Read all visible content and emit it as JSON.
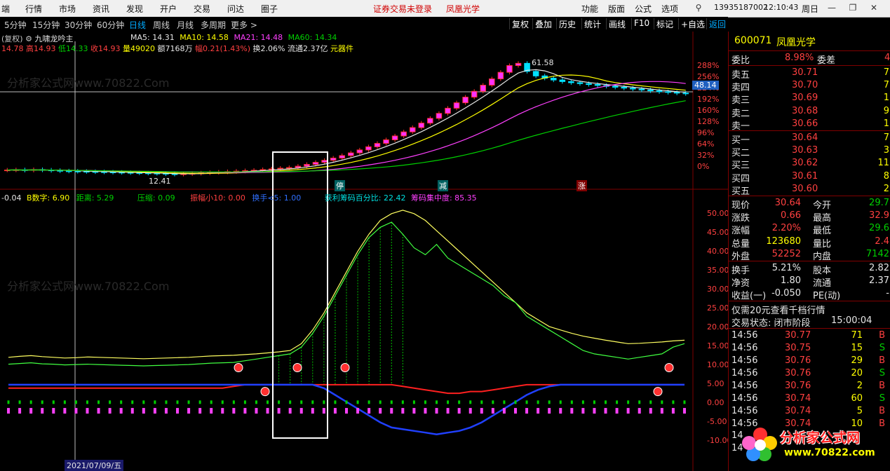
{
  "menu": {
    "items": [
      "端",
      "行情",
      "市场",
      "资讯",
      "发现",
      "开户",
      "交易",
      "问达",
      "圈子"
    ],
    "notice": "证券交易未登录",
    "stock_name": "凤凰光学",
    "right_items": [
      "功能",
      "版面",
      "公式",
      "选项"
    ],
    "account": "13935187002",
    "time": "12:10:43",
    "weekday": "周日"
  },
  "period_bar": {
    "periods": [
      "5分钟",
      "15分钟",
      "30分钟",
      "60分钟",
      "日线",
      "周线",
      "月线",
      "多周期",
      "更多 >"
    ],
    "active": "日线",
    "tools": [
      "复权",
      "叠加",
      "历史",
      "统计",
      "画线",
      "F10",
      "标记",
      "+自选",
      "返回"
    ]
  },
  "kline": {
    "header": {
      "prefix": "(复权)",
      "indicator_name": "九啸龙吟主",
      "ma5": "MA5: 14.31",
      "ma10": "MA10: 14.58",
      "ma21": "MA21: 14.48",
      "ma60": "MA60: 14.34"
    },
    "quote_line": {
      "open": "14.78",
      "high": "高14.93",
      "low": "低14.33",
      "close": "收14.93",
      "volume": "量49020",
      "amount": "额7168万",
      "change": "幅0.21(1.43%)",
      "turnover": "换2.06%",
      "float": "流通2.37亿",
      "component": "元器件"
    },
    "y_labels": [
      "288%",
      "256%",
      "224%",
      "192%",
      "160%",
      "128%",
      "96%",
      "64%",
      "32%",
      "0%"
    ],
    "price_tag": "48.14",
    "peak_label": "61.58",
    "low_label": "12.41",
    "signals": {
      "start": "停",
      "mid": "减",
      "up": "涨"
    },
    "close_series": [
      14.3,
      14.4,
      14.2,
      14.5,
      14.3,
      14.1,
      13.9,
      13.8,
      13.7,
      13.6,
      13.5,
      13.4,
      13.3,
      13.2,
      13.1,
      13.0,
      12.9,
      12.8,
      12.6,
      12.41,
      12.6,
      12.8,
      13.0,
      13.2,
      13.4,
      13.6,
      13.8,
      14.0,
      14.2,
      14.5,
      14.8,
      15.1,
      15.4,
      16.0,
      16.8,
      17.7,
      18.6,
      19.6,
      20.7,
      21.9,
      23.2,
      24.6,
      26.1,
      27.7,
      29.4,
      31.2,
      33.1,
      35.1,
      37.2,
      39.4,
      41.7,
      44.1,
      46.6,
      49.2,
      51.9,
      54.7,
      57.6,
      60.6,
      61.58,
      58.0,
      56.0,
      55.0,
      54.2,
      53.5,
      53.0,
      52.6,
      52.2,
      51.8,
      51.4,
      51.0,
      50.6,
      50.2,
      49.8,
      49.4,
      49.0,
      48.7,
      48.4,
      48.14
    ]
  },
  "sub": {
    "header": {
      "a": "-0.04",
      "b": "B数字: 6.90",
      "distance": "距离: 5.29",
      "compress": "压缩: 0.09",
      "amplitude": "振幅小10: 0.00",
      "turnover5": "换手<5: 1.00",
      "profit": "获利筹码百分比: 22.42",
      "concentration": "筹码集中度: 85.35"
    },
    "y_labels": [
      "50.00",
      "45.00",
      "40.00",
      "35.00",
      "30.00",
      "25.00",
      "20.00",
      "15.00",
      "10.00",
      "5.00",
      "0.00",
      "-5.00",
      "-10.00"
    ],
    "yellow_series": [
      8,
      8.3,
      8.5,
      8.2,
      8,
      7.8,
      7.9,
      8.1,
      8,
      7.9,
      7.8,
      7.7,
      7.6,
      7.7,
      7.8,
      7.9,
      8,
      8.2,
      8.4,
      8.5,
      8.6,
      8.8,
      9,
      9.3,
      9.6,
      10,
      12,
      16,
      21,
      27,
      33,
      39,
      44,
      48,
      50,
      51,
      50,
      48,
      45,
      42,
      39,
      36,
      33,
      30,
      27,
      24,
      21,
      19,
      17,
      16,
      15,
      14.2,
      13.6,
      13,
      12.5,
      12,
      12.1,
      12.3,
      12.5,
      12.8,
      13
    ],
    "green_series": [
      6,
      6.2,
      6.4,
      6.1,
      6,
      5.8,
      5.9,
      6,
      5.9,
      5.8,
      5.7,
      5.6,
      5.5,
      5.6,
      5.7,
      5.8,
      5.9,
      6.1,
      6.3,
      6.4,
      6.5,
      7,
      7.5,
      8,
      8.5,
      9,
      11,
      15,
      20,
      26,
      32,
      38,
      43,
      46,
      47.5,
      44,
      40,
      38,
      41,
      37,
      35,
      33,
      31,
      29,
      26,
      24,
      20,
      18,
      16,
      14,
      12,
      10,
      9,
      8.5,
      8,
      7.5,
      8,
      8.5,
      9,
      11,
      12
    ],
    "blue_series": [
      0,
      0,
      0,
      0,
      0,
      0,
      0,
      0,
      0,
      0,
      0,
      0,
      0,
      0,
      0,
      0,
      0,
      0,
      0,
      0,
      0,
      0,
      0,
      0,
      0,
      0,
      0,
      0,
      -1,
      -3,
      -5,
      -7,
      -9,
      -11,
      -12.5,
      -13,
      -13.5,
      -14,
      -14.5,
      -14,
      -13.5,
      -12.5,
      -11,
      -9,
      -7,
      -5,
      -3,
      -1.5,
      -0.5,
      0,
      0,
      0,
      0,
      0,
      0,
      0,
      0,
      0,
      0,
      0,
      0
    ],
    "red_series": [
      -1,
      -1,
      -1,
      -1,
      -1,
      -1,
      -1,
      -1,
      -1,
      -1,
      -1,
      -1,
      -1,
      -1,
      -1,
      -1,
      -1,
      -1,
      -1,
      -1,
      -0.5,
      0,
      0,
      0,
      0,
      0,
      0,
      0,
      0,
      0,
      0,
      0,
      0,
      0,
      0,
      -0.5,
      -1,
      -1.5,
      -2,
      -2.5,
      -2.5,
      -2,
      -2,
      -1.5,
      -1,
      -0.5,
      0,
      0,
      0,
      0,
      0,
      0,
      0,
      0,
      0,
      0,
      0,
      0,
      0,
      0,
      0
    ]
  },
  "date_tag": "2021/07/09/五",
  "watermark": "分析家公式网www.70822.Com",
  "quote": {
    "code": "600071",
    "name": "凤凰光学",
    "weibi_label": "委比",
    "weibi": "8.98%",
    "weicha_label": "委差",
    "weicha": "4",
    "asks": [
      {
        "label": "卖五",
        "price": "30.71",
        "vol": "7"
      },
      {
        "label": "卖四",
        "price": "30.70",
        "vol": "7"
      },
      {
        "label": "卖三",
        "price": "30.69",
        "vol": "1"
      },
      {
        "label": "卖二",
        "price": "30.68",
        "vol": "9"
      },
      {
        "label": "卖一",
        "price": "30.66",
        "vol": "1"
      }
    ],
    "bids": [
      {
        "label": "买一",
        "price": "30.64",
        "vol": "7"
      },
      {
        "label": "买二",
        "price": "30.63",
        "vol": "3"
      },
      {
        "label": "买三",
        "price": "30.62",
        "vol": "11"
      },
      {
        "label": "买四",
        "price": "30.61",
        "vol": "8"
      },
      {
        "label": "买五",
        "price": "30.60",
        "vol": "2"
      }
    ],
    "stats": [
      {
        "l1": "现价",
        "v1": "30.64",
        "l2": "今开",
        "v2": "29.7",
        "c1": "red",
        "c2": "green"
      },
      {
        "l1": "涨跌",
        "v1": "0.66",
        "l2": "最高",
        "v2": "32.9",
        "c1": "red",
        "c2": "red"
      },
      {
        "l1": "涨幅",
        "v1": "2.20%",
        "l2": "最低",
        "v2": "29.6",
        "c1": "red",
        "c2": "green"
      },
      {
        "l1": "总量",
        "v1": "123680",
        "l2": "量比",
        "v2": "2.4",
        "c1": "yellow",
        "c2": "red"
      },
      {
        "l1": "外盘",
        "v1": "52252",
        "l2": "内盘",
        "v2": "7142",
        "c1": "red",
        "c2": "green"
      }
    ],
    "stats2": [
      {
        "l1": "换手",
        "v1": "5.21%",
        "l2": "股本",
        "v2": "2.82"
      },
      {
        "l1": "净资",
        "v1": "1.80",
        "l2": "流通",
        "v2": "2.37"
      },
      {
        "l1": "收益(一)",
        "v1": "-0.050",
        "l2": "PE(动)",
        "v2": "-"
      }
    ],
    "promo": "仅需20元查看千档行情",
    "trade_status_label": "交易状态: 闭市阶段",
    "trade_time": "15:00:04",
    "ticks": [
      {
        "time": "14:56",
        "price": "30.77",
        "vol": "71",
        "bs": "B"
      },
      {
        "time": "14:56",
        "price": "30.75",
        "vol": "15",
        "bs": "S"
      },
      {
        "time": "14:56",
        "price": "30.76",
        "vol": "29",
        "bs": "B"
      },
      {
        "time": "14:56",
        "price": "30.76",
        "vol": "20",
        "bs": "S"
      },
      {
        "time": "14:56",
        "price": "30.76",
        "vol": "2",
        "bs": "B"
      },
      {
        "time": "14:56",
        "price": "30.74",
        "vol": "60",
        "bs": "S"
      },
      {
        "time": "14:56",
        "price": "30.74",
        "vol": "5",
        "bs": "B"
      },
      {
        "time": "14:56",
        "price": "30.74",
        "vol": "10",
        "bs": "B"
      }
    ]
  },
  "logo": {
    "title": "分析家公式网",
    "url": "www.70822.com"
  }
}
